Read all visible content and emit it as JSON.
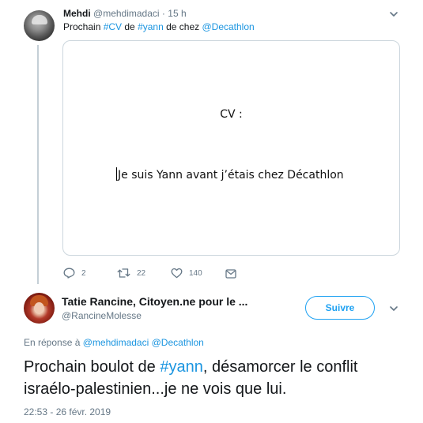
{
  "tweet1": {
    "name": "Mehdi",
    "handle": "@mehdimadaci",
    "separator": "·",
    "time": "15 h",
    "text_before": "Prochain ",
    "hashtag1": "#CV",
    "text_mid": " de ",
    "hashtag2": "#yann",
    "text_mid2": " de chez ",
    "mention": "@Decathlon",
    "image": {
      "title": "CV :",
      "body": "Je suis Yann avant j’étais chez Décathlon"
    },
    "actions": {
      "replies": "2",
      "retweets": "22",
      "likes": "140"
    }
  },
  "tweet2": {
    "name": "Tatie Rancine, Citoyen.ne pour le ...",
    "handle": "@RancineMolesse",
    "follow_label": "Suivre",
    "reply_prefix": "En réponse à ",
    "reply_mention1": "@mehdimadaci",
    "reply_mention2": "@Decathlon",
    "text_before": "Prochain boulot de ",
    "hashtag": "#yann",
    "text_after": ", désamorcer le conflit israélo-palestinien...je ne vois que lui.",
    "timestamp": "22:53 - 26 févr. 2019"
  },
  "colors": {
    "link": "#1b95e0",
    "follow": "#1da1f2",
    "muted": "#657786"
  },
  "icons": [
    "chevron-down-icon",
    "reply-icon",
    "retweet-icon",
    "like-icon",
    "direct-message-icon"
  ]
}
